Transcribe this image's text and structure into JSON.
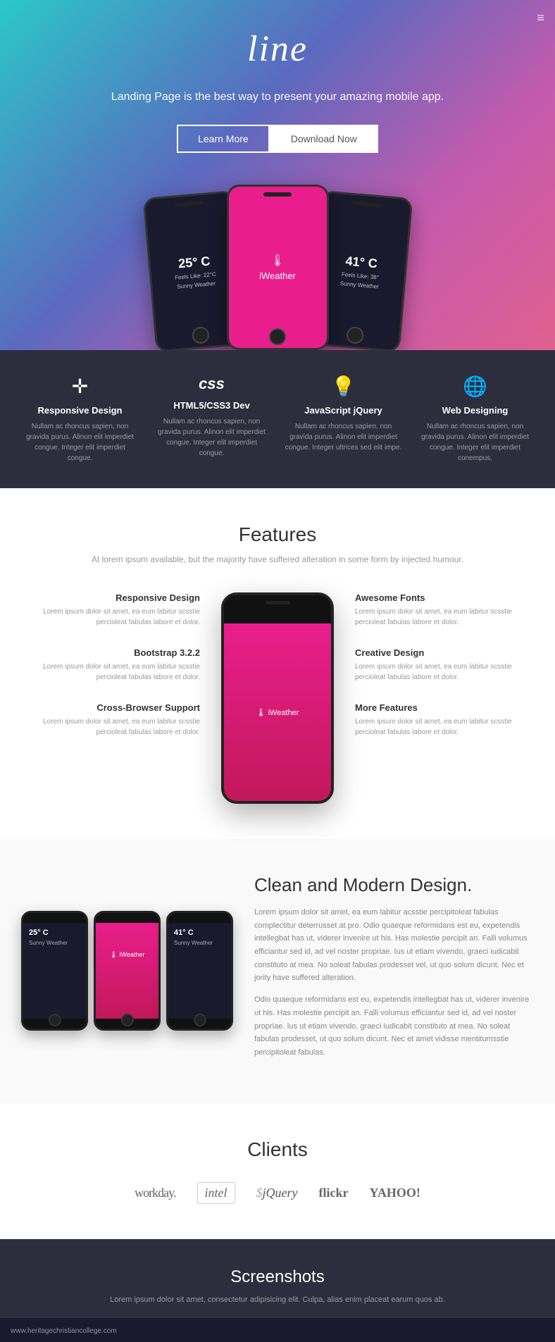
{
  "hero": {
    "title": "line",
    "subtitle": "Landing Page is the best way to present your amazing mobile app.",
    "btn_learn": "Learn More",
    "btn_download": "Download Now",
    "menu_icon": "≡"
  },
  "features_icons": {
    "items": [
      {
        "icon": "✛",
        "title": "Responsive Design",
        "desc": "Nullam ac rhoncus sapien, non gravida purus. Alinon elit imperdiet congue. Integer elit imperdiet congue."
      },
      {
        "icon": "❑",
        "title": "HTML5/CSS3 Dev",
        "desc": "Nullam ac rhoncus sapien, non gravida purus. Alinon elit imperdiet congue. Integer elit imperdiet congue."
      },
      {
        "icon": "💡",
        "title": "JavaScript jQuery",
        "desc": "Nullam ac rhoncus sapien, non gravida purus. Alinon elit imperdiet congue. Integer ultrices sed elit impe."
      },
      {
        "icon": "🌐",
        "title": "Web Designing",
        "desc": "Nullam ac rhoncus sapien, non gravida purus. Alinon elit imperdiet congue. Integer elit imperdiet conempus."
      }
    ]
  },
  "features_section": {
    "title": "Features",
    "subtitle": "At lorem ipsum available, but the majority have suffered alteration in some form by injected humour.",
    "left_items": [
      {
        "title": "Responsive Design",
        "desc": "Lorem ipsum dolor sit amet, ea eum labitur scsstie percioleat fabulas labore et dolor."
      },
      {
        "title": "Bootstrap 3.2.2",
        "desc": "Lorem ipsum dolor sit amet, ea eum labitur scsstie percioleat fabulas labore et dolor."
      },
      {
        "title": "Cross-Browser Support",
        "desc": "Lorem ipsum dolor sit amet, ea eum labitur scsstie percioleat fabulas labore et dolor."
      }
    ],
    "right_items": [
      {
        "title": "Awesome Fonts",
        "desc": "Lorem ipsum dolor sit amet, ea eum labitur scsstie percioleat fabulas labore et dolor."
      },
      {
        "title": "Creative Design",
        "desc": "Lorem ipsum dolor sit amet, ea eum labitur scsstie percioleat fabulas labore et dolor."
      },
      {
        "title": "More Features",
        "desc": "Lorem ipsum dolor sit amet, ea eum labitur scsstie percioleat fabulas labore et dolor."
      }
    ]
  },
  "modern_section": {
    "title": "Clean and Modern Design.",
    "para1": "Lorem ipsum dolor sit amet, ea eum labitur acsstie percipitoleat fabulas complectitur deterrusset at pro. Odio quaeque reformidans est eu, expetendis intellegbat has ut, viderer invenire ut his. Has molestie percipit an. Falli volumus efficiantur sed id, ad vel noster propriae. Ius ut etiam vivendo, graeci iudicabit constituto at mea. No soleat fabulas prodesset vel, ut quo solum dicunt. Nec et jority have suffered alteration.",
    "para2": "Odio quaeque reformidans est eu, expetendis intellegbat has ut, viderer invenire ut his. Has molestie percipit an. Falli volumus efficiantur sed id, ad vel noster propriae. Ius ut etiam vivendo, graeci iudicabit constituto at mea. No soleat fabulas prodesset, ut quo solum dicunt. Nec et amet vidisse mentitumsstie percipitoleat fabulas."
  },
  "clients_section": {
    "title": "Clients",
    "logos": [
      {
        "name": "workday.",
        "style": "workday"
      },
      {
        "name": "intel",
        "style": "intel"
      },
      {
        "name": "jQuery",
        "style": "jquery"
      },
      {
        "name": "flickr",
        "style": "flickr"
      },
      {
        "name": "YAHOO!",
        "style": "yahoo"
      }
    ]
  },
  "screenshots_section": {
    "title": "Screenshots",
    "subtitle": "Lorem ipsum dolor sit amet, consectetur adipisicing elit. Culpa, alias enim placeat earum quos ab."
  },
  "bottom_bar": {
    "text": "www.heritagechristiancollege.com"
  },
  "iweather_label": "iWeather",
  "phone_weather_left": {
    "temp": "25° C",
    "sub1": "Feels Like: 22°C",
    "sub2": "Sunny Weather"
  },
  "phone_weather_right": {
    "temp": "41° C",
    "sub1": "Feels Like: 38°",
    "sub2": "Sunny Weather"
  }
}
